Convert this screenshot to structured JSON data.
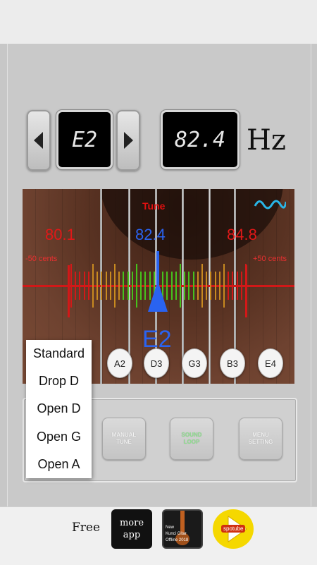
{
  "note_selector": {
    "note": "E2",
    "prev_icon": "triangle-left-icon",
    "next_icon": "triangle-right-icon"
  },
  "frequency": {
    "value": "82.4",
    "unit": "Hz"
  },
  "tuner": {
    "title": "Tune",
    "wave_icon": "wave-icon",
    "left_freq": "80.1",
    "center_freq": "82.4",
    "right_freq": "84.8",
    "left_cents": "-50 cents",
    "right_cents": "+50 cents",
    "detected_note": "E2",
    "colors": {
      "red": "#d21818",
      "blue": "#2a63f0",
      "green": "#46c21d",
      "orange": "#c88a20"
    }
  },
  "string_buttons": [
    "A2",
    "D3",
    "G3",
    "B3",
    "E4"
  ],
  "tuning_menu": [
    "Standard",
    "Drop D",
    "Open D",
    "Open G",
    "Open A"
  ],
  "controls": {
    "manual_tune": "MANUAL\nTUNE",
    "sound_loop": "SOUND\nLOOP",
    "menu_setting": "MENU\nSETTING"
  },
  "footer": {
    "free_label": "Free",
    "more_app": "more\napp",
    "ad1_lines": [
      "New",
      "Kunci Gitar",
      "Offline 2018"
    ],
    "ad2_label": "spotube"
  }
}
